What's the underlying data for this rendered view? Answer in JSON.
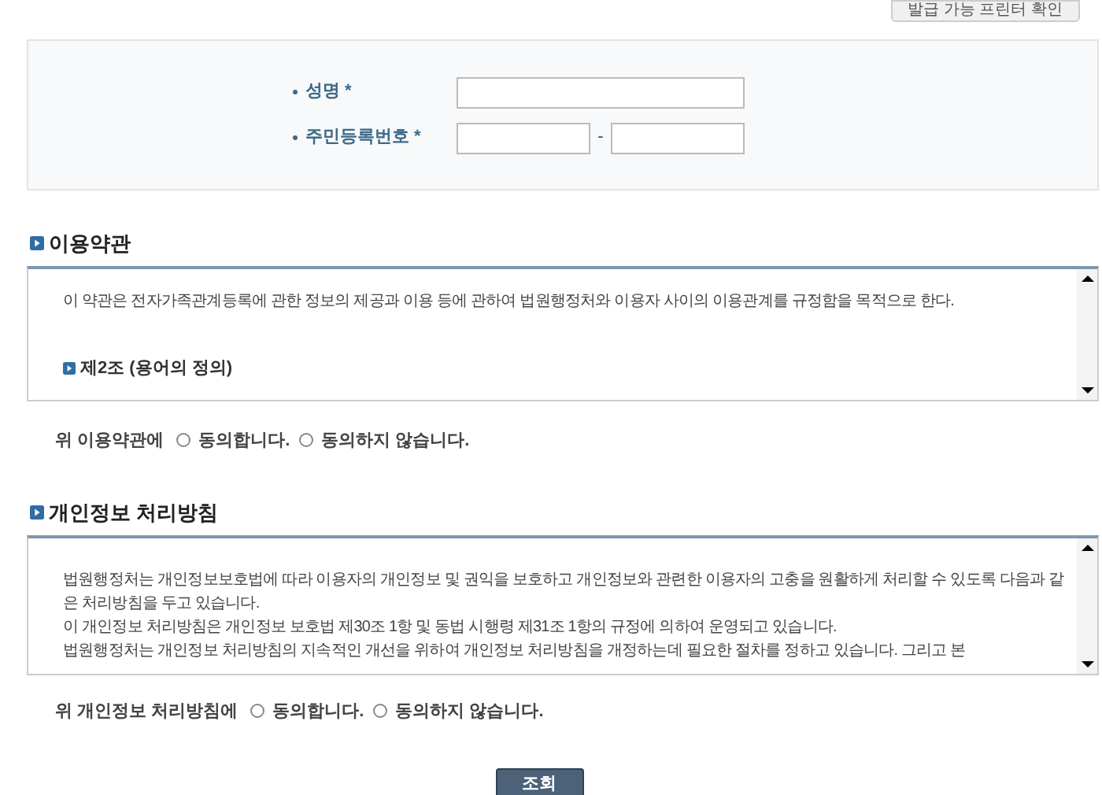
{
  "top_button": "발급 가능 프린터 확인",
  "form": {
    "fields": [
      {
        "label": "성명 *",
        "kind": "single"
      },
      {
        "label": "주민등록번호 *",
        "kind": "split",
        "separator": "-"
      }
    ]
  },
  "terms": {
    "title": "이용약관",
    "paragraphs": [
      {
        "kind": "text",
        "text": "이 약관은 전자가족관계등록에 관한 정보의 제공과 이용 등에 관하여 법원행정처와 이용자 사이의 이용관계를 규정함을 목적으로 한다."
      },
      {
        "kind": "heading",
        "text": "제2조 (용어의 정의)"
      }
    ],
    "consent": {
      "prompt": "위 이용약관에",
      "options": [
        {
          "label": "동의합니다.",
          "selected": false
        },
        {
          "label": "동의하지 않습니다.",
          "selected": false
        }
      ]
    }
  },
  "privacy": {
    "title": "개인정보 처리방침",
    "paragraphs": [
      {
        "kind": "text",
        "text": "법원행정처는 개인정보보호법에 따라 이용자의 개인정보 및 권익을 보호하고 개인정보와 관련한 이용자의 고충을 원활하게 처리할 수 있도록 다음과 같은 처리방침을 두고 있습니다."
      },
      {
        "kind": "text",
        "text": "이 개인정보 처리방침은 개인정보 보호법 제30조 1항 및 동법 시행령 제31조 1항의 규정에 의하여 운영되고 있습니다."
      },
      {
        "kind": "text",
        "text": "법원행정처는 개인정보 처리방침의 지속적인 개선을 위하여 개인정보 처리방침을 개정하는데 필요한 절차를 정하고 있습니다. 그리고 본"
      }
    ],
    "consent": {
      "prompt": "위 개인정보 처리방침에",
      "options": [
        {
          "label": "동의합니다.",
          "selected": false
        },
        {
          "label": "동의하지 않습니다.",
          "selected": false
        }
      ]
    }
  },
  "submit": "조회"
}
